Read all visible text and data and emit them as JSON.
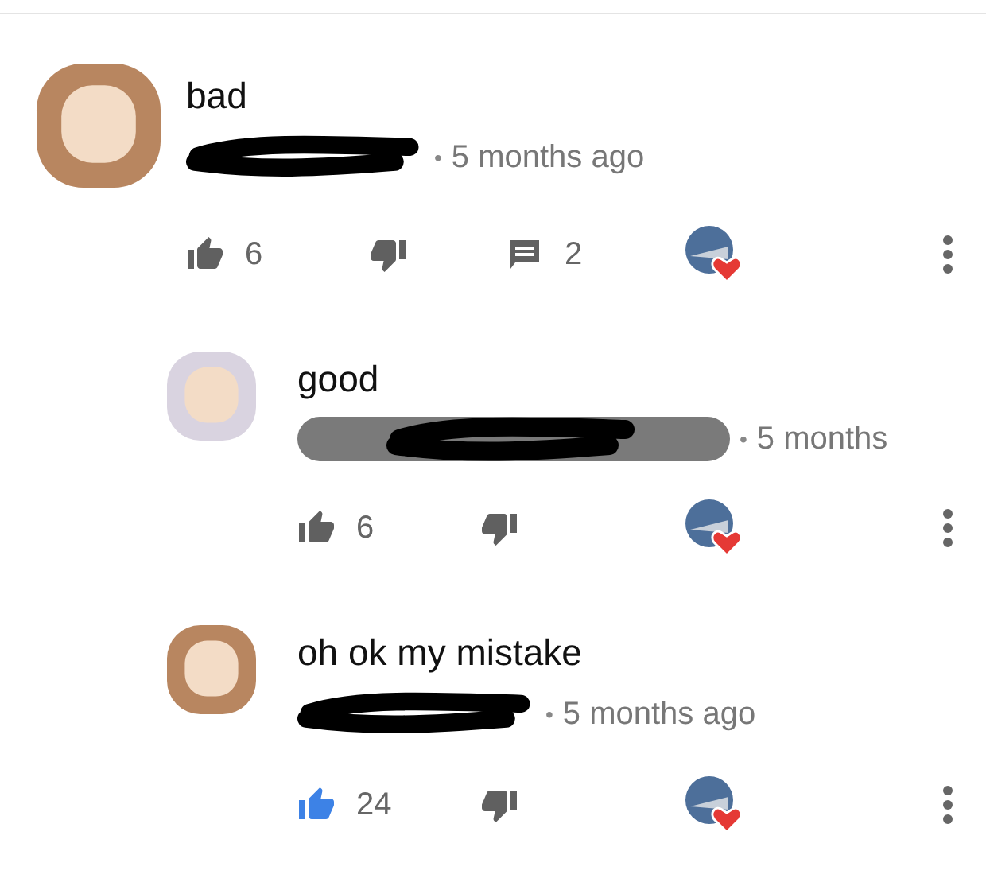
{
  "comments": [
    {
      "kind": "top",
      "avatar": {
        "color": "#b88660"
      },
      "text": "bad",
      "author_badge": false,
      "separator": "•",
      "time": "5 months ago",
      "likes": "6",
      "liked": false,
      "replies": "2",
      "hearted": true
    },
    {
      "kind": "reply",
      "avatar": {
        "color": "#d9d3e0"
      },
      "text": "good",
      "author_badge": true,
      "separator": "•",
      "time": "5 months",
      "likes": "6",
      "liked": false,
      "hearted": true
    },
    {
      "kind": "reply",
      "avatar": {
        "color": "#b88660"
      },
      "text": "oh ok my mistake",
      "author_badge": false,
      "separator": "•",
      "time": "5 months ago",
      "likes": "24",
      "liked": true,
      "hearted": true
    }
  ]
}
